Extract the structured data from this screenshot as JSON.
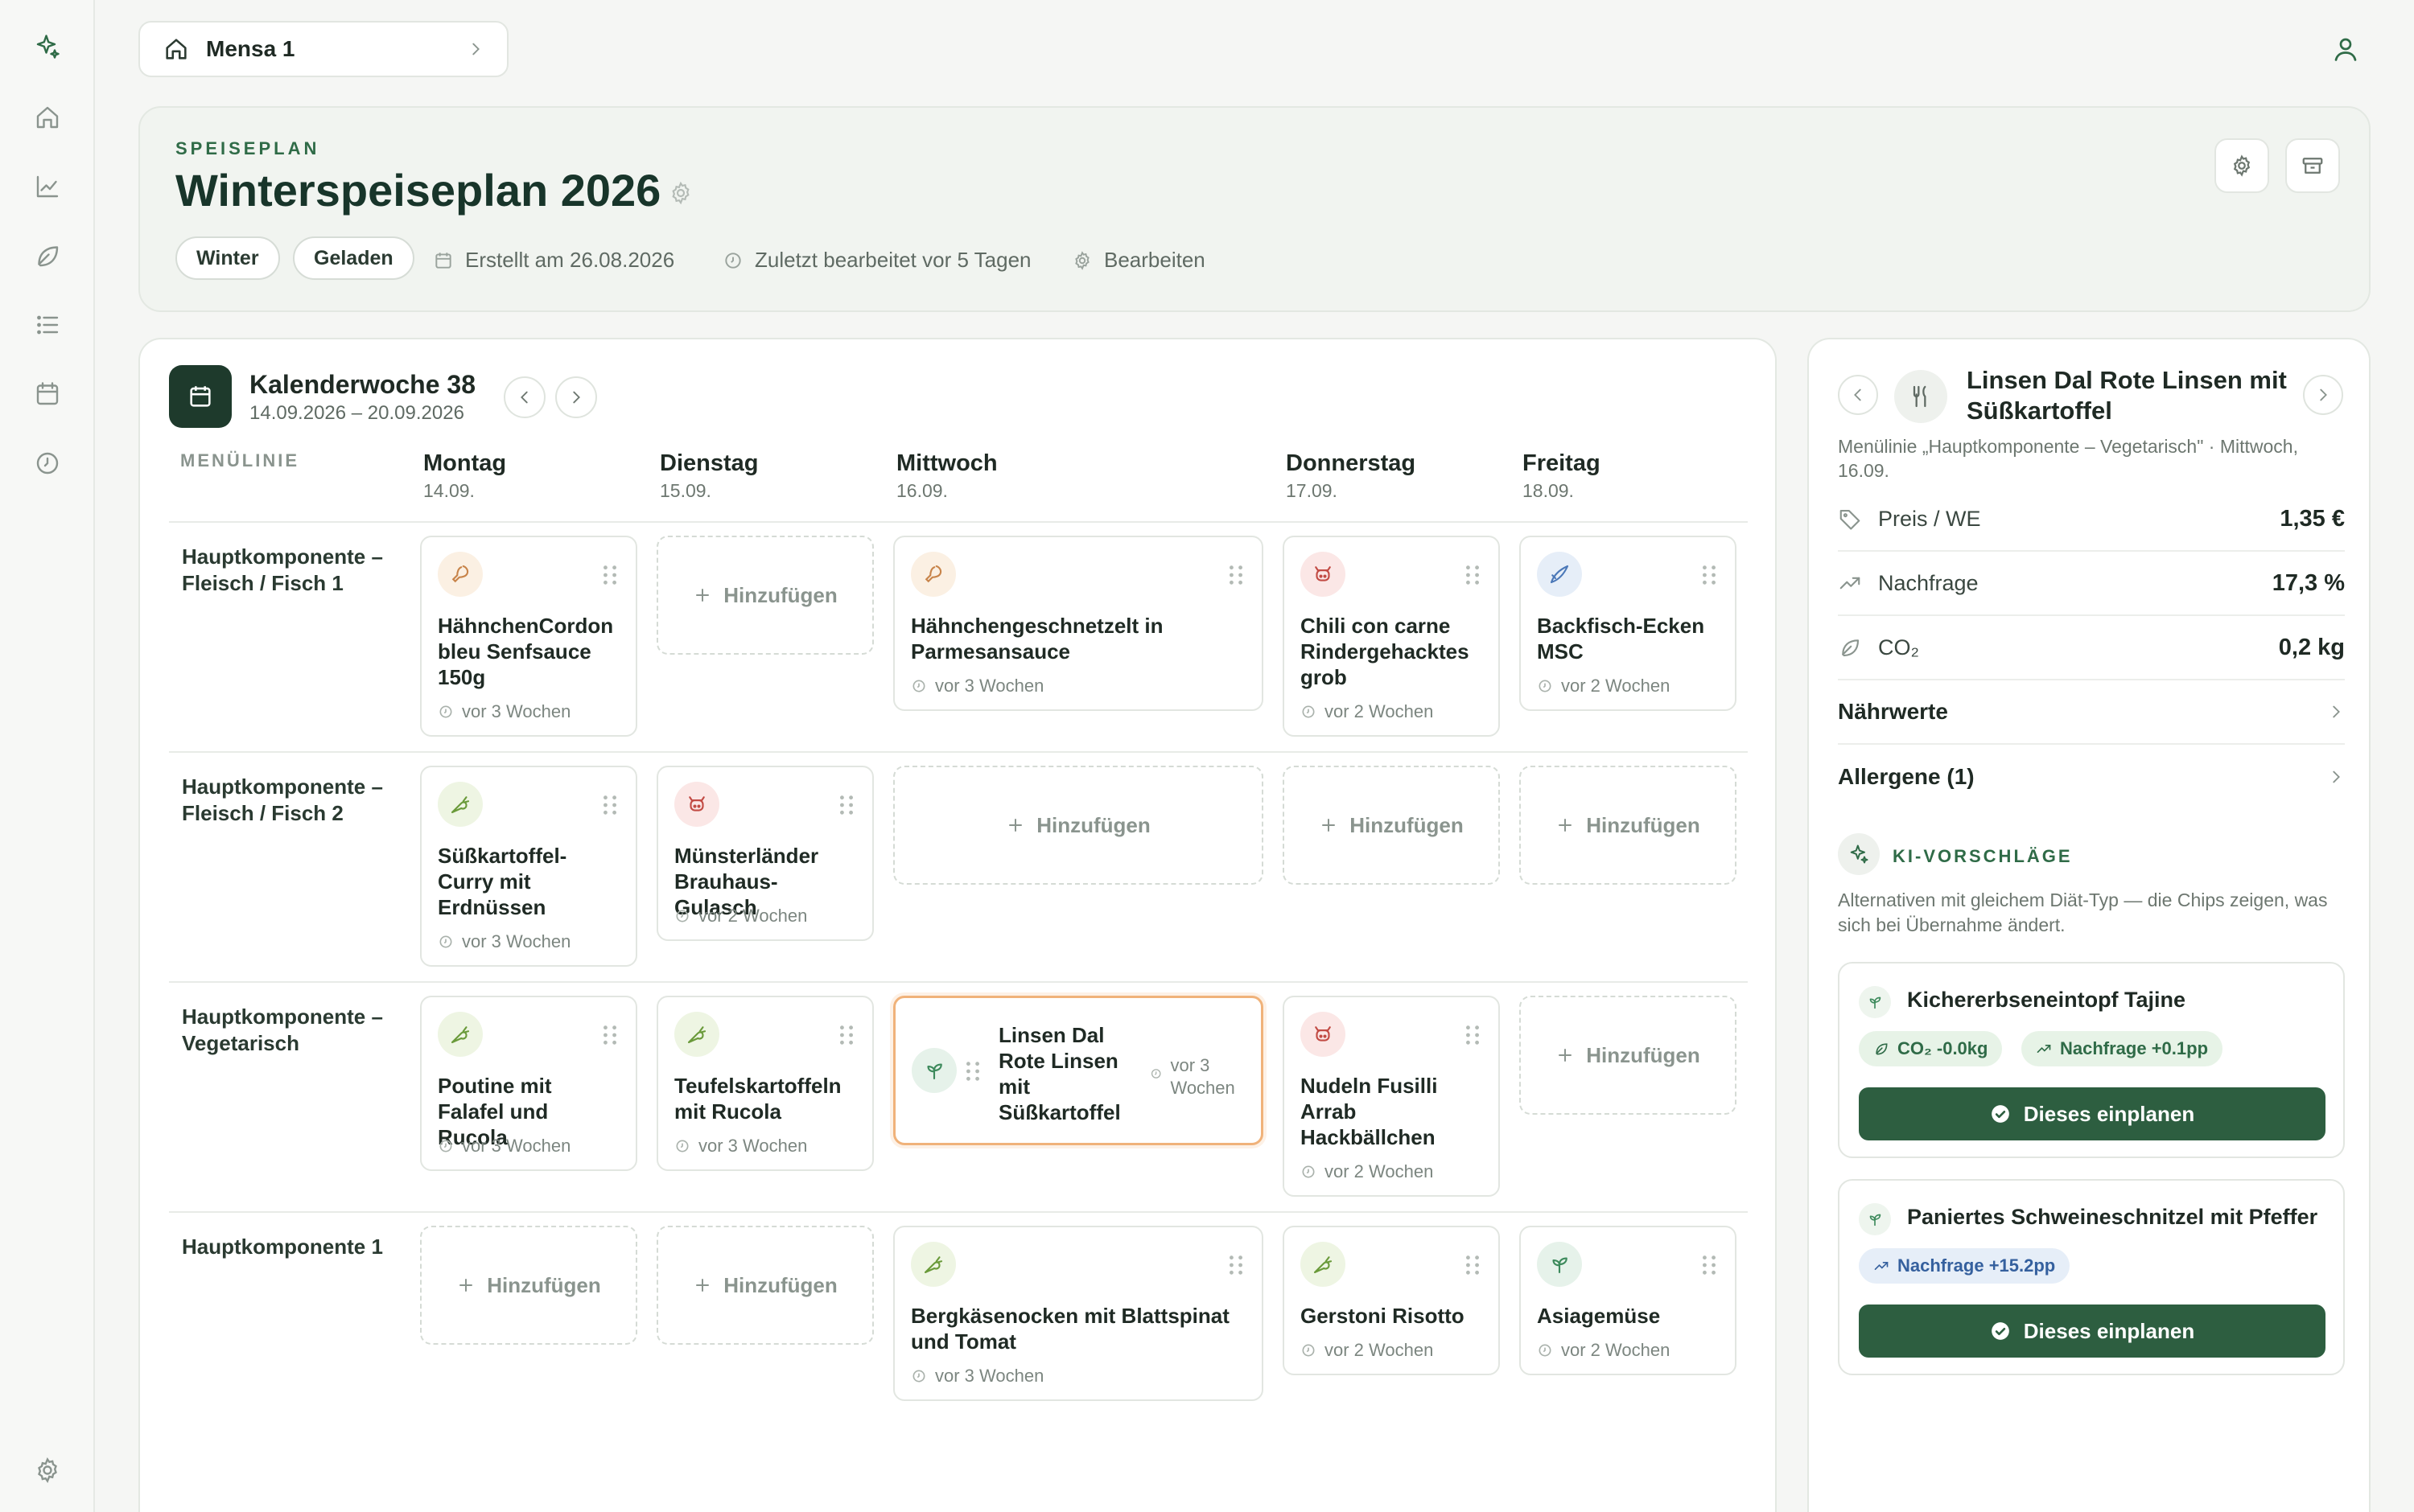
{
  "breadcrumb": {
    "label": "Mensa 1"
  },
  "header": {
    "eyebrow": "SPEISEPLAN",
    "title": "Winterspeiseplan 2026",
    "chips": [
      "Winter",
      "Geladen"
    ],
    "created": "Erstellt am 26.08.2026",
    "edited": "Zuletzt bearbeitet vor 5 Tagen",
    "edit_label": "Bearbeiten"
  },
  "calendar": {
    "week_title": "Kalenderwoche 38",
    "week_range": "14.09.2026 – 20.09.2026",
    "menu_line_header": "MENÜLINIE",
    "add_label": "Hinzufügen",
    "days": [
      {
        "name": "Montag",
        "date": "14.09."
      },
      {
        "name": "Dienstag",
        "date": "15.09."
      },
      {
        "name": "Mittwoch",
        "date": "16.09."
      },
      {
        "name": "Donnerstag",
        "date": "17.09."
      },
      {
        "name": "Freitag",
        "date": "18.09."
      }
    ],
    "rows": [
      {
        "label": "Hauptkomponente – Fleisch / Fisch 1"
      },
      {
        "label": "Hauptkomponente – Fleisch / Fisch 2"
      },
      {
        "label": "Hauptkomponente – Vegetarisch"
      },
      {
        "label": "Hauptkomponente 1"
      }
    ],
    "meals": {
      "r0_mon": {
        "name": "HähnchenCordon bleu Senfsauce 150g",
        "time": "vor 3 Wochen",
        "icon": "chicken-icon"
      },
      "r0_wed": {
        "name": "Hähnchengeschnetzelt in Parmesansauce",
        "time": "vor 3 Wochen",
        "icon": "chicken-icon"
      },
      "r0_thu": {
        "name": "Chili con carne Rindergehacktes grob",
        "time": "vor 2 Wochen",
        "icon": "beef-icon"
      },
      "r0_fri": {
        "name": "Backfisch-Ecken MSC",
        "time": "vor 2 Wochen",
        "icon": "fish-icon"
      },
      "r1_mon": {
        "name": "Süßkartoffel-Curry mit Erdnüssen",
        "time": "vor 3 Wochen",
        "icon": "carrot-icon"
      },
      "r1_tue": {
        "name": "Münsterländer Brauhaus-Gulasch",
        "time": "vor 2 Wochen",
        "icon": "beef-icon"
      },
      "r2_mon": {
        "name": "Poutine mit Falafel und Rucola",
        "time": "vor 3 Wochen",
        "icon": "carrot-icon"
      },
      "r2_tue": {
        "name": "Teufelskartoffeln mit Rucola",
        "time": "vor 3 Wochen",
        "icon": "carrot-icon"
      },
      "r2_wed": {
        "name": "Linsen Dal Rote Linsen mit Süßkartoffel",
        "time": "vor 3 Wochen",
        "icon": "sprout-icon"
      },
      "r2_thu": {
        "name": "Nudeln Fusilli Arrab Hackbällchen",
        "time": "vor 2 Wochen",
        "icon": "beef-icon"
      },
      "r3_wed": {
        "name": "Bergkäsenocken mit Blattspinat und Tomat",
        "time": "vor 3 Wochen",
        "icon": "carrot-icon"
      },
      "r3_thu": {
        "name": "Gerstoni Risotto",
        "time": "vor 2 Wochen",
        "icon": "carrot-icon"
      },
      "r3_fri": {
        "name": "Asiagemüse",
        "time": "vor 2 Wochen",
        "icon": "sprout-icon"
      }
    }
  },
  "panel": {
    "title": "Linsen Dal Rote Linsen mit Süßkartoffel",
    "subtitle": "Menülinie „Hauptkomponente – Vegetarisch\" · Mittwoch, 16.09.",
    "price_label": "Preis / WE",
    "price_value": "1,35 €",
    "demand_label": "Nachfrage",
    "demand_value": "17,3 %",
    "co2_label": "CO₂",
    "co2_value": "0,2 kg",
    "nutrition_label": "Nährwerte",
    "allergens_label": "Allergene (1)",
    "ki_title": "KI-VORSCHLÄGE",
    "ki_sub": "Alternativen mit gleichem Diät-Typ — die Chips zeigen, was sich bei Übernahme ändert.",
    "suggestions": [
      {
        "name": "Kichererbseneintopf Tajine",
        "chips": [
          "CO₂ -0.0kg",
          "Nachfrage +0.1pp"
        ],
        "button": "Dieses einplanen"
      },
      {
        "name": "Paniertes Schweineschnitzel mit Pfeffer",
        "chips": [
          "Nachfrage +15.2pp"
        ],
        "button": "Dieses einplanen"
      }
    ]
  },
  "colors": {
    "accent": "#2f6b47",
    "button": "#2d5e40",
    "selected_border": "#f0b27a"
  }
}
